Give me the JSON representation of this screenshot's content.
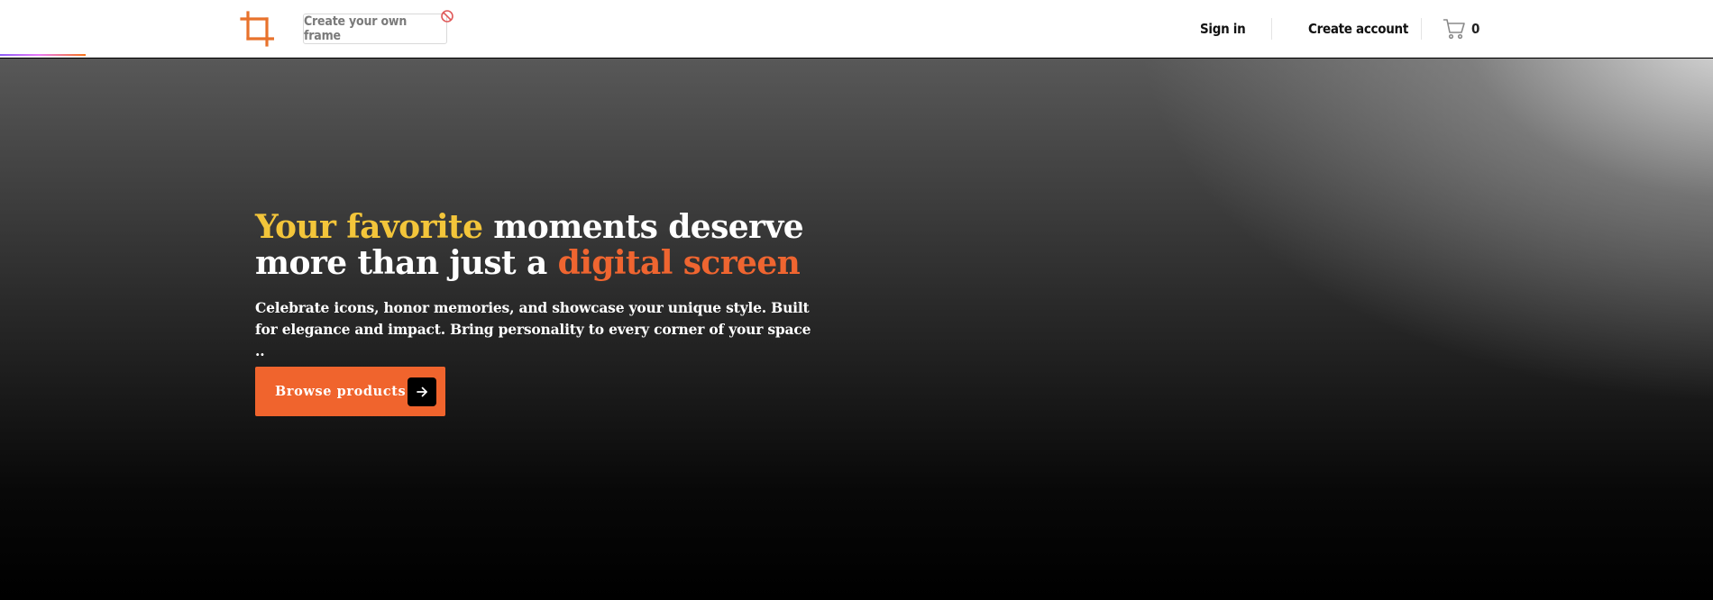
{
  "header": {
    "create_frame_label": "Create your own frame",
    "signin_label": "Sign in",
    "create_account_label": "Create account",
    "cart_count": "0",
    "scroll_progress_fraction": 0.05
  },
  "hero": {
    "headline": {
      "part1": "Your favorite",
      "part2": " moments deserve more than just a ",
      "part3": "digital screen"
    },
    "subtitle": "Celebrate icons, honor memories, and showcase your unique style. Built for elegance and impact. Bring personality to every corner of your space ..",
    "cta_label": "Browse products"
  },
  "icons": {
    "logo": "crop-icon",
    "not_allowed": "prohibited-icon",
    "cart": "cart-icon",
    "arrow": "arrow-right-icon"
  },
  "colors": {
    "accent_orange": "#f0642d",
    "headline_yellow": "#f3c53a",
    "headline_orange": "#ef6530",
    "progress_start": "#8b5cf6",
    "progress_end": "#f97316"
  }
}
